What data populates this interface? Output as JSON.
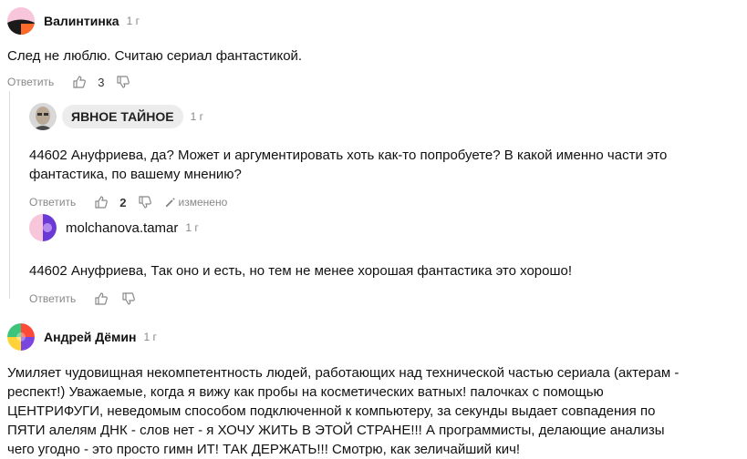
{
  "comments": [
    {
      "author": "Валинтинка",
      "time": "1 г",
      "text": "След не люблю. Считаю сериал фантастикой.",
      "reply_label": "Ответить",
      "likes": "3"
    },
    {
      "author": "ЯВНОЕ ТАЙНОЕ",
      "time": "1 г",
      "text": "44602 Ануфриева, да? Может и аргументировать хоть как-то попробуете? В какой именно части это фантастика, по вашему мнению?",
      "reply_label": "Ответить",
      "likes": "2",
      "edited_label": "изменено"
    },
    {
      "author": "molchanova.tamar",
      "time": "1 г",
      "text": "44602 Ануфриева, Так оно и есть, но тем не менее хорошая фантастика это хорошо!",
      "reply_label": "Ответить"
    },
    {
      "author": "Андрей Дёмин",
      "time": "1 г",
      "text": "Умиляет чудовищная некомпетентность людей, работающих над технической частью сериала (актерам - респект!) Уважаемые, когда я вижу как пробы на косметических ватных! палочках с помощью ЦЕНТРИФУГИ, неведомым способом подключенной к компьютеру, за секунды выдает совпадения по ПЯТИ алелям ДНК - слов нет - я ХОЧУ ЖИТЬ В ЭТОЙ СТРАНЕ!!! А программисты, делающие анализы чего угодно - это просто гимн ИТ! ТАК ДЕРЖАТЬ!!! Смотрю, как зеличайший кич!"
    }
  ],
  "icons": {
    "like": "thumb-up-icon",
    "dislike": "thumb-down-icon",
    "edited": "pencil-icon"
  }
}
